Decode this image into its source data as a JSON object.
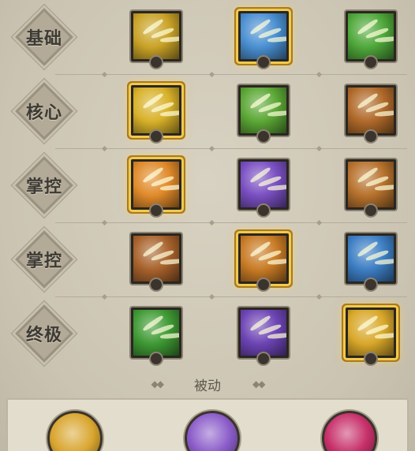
{
  "rows": [
    {
      "label": "基础",
      "skills": [
        {
          "icon": "golden-axe-icon",
          "color": "#c9a227",
          "selected": false
        },
        {
          "icon": "ice-axe-icon",
          "color": "#4a8fd1",
          "selected": true
        },
        {
          "icon": "green-axe-slash-icon",
          "color": "#4fa83a",
          "selected": false
        }
      ]
    },
    {
      "label": "核心",
      "skills": [
        {
          "icon": "golden-whirlwind-icon",
          "color": "#d8b12a",
          "selected": true
        },
        {
          "icon": "green-shatter-icon",
          "color": "#5ba735",
          "selected": false
        },
        {
          "icon": "bronze-totem-icon",
          "color": "#b06a2a",
          "selected": false
        }
      ]
    },
    {
      "label": "掌控",
      "skills": [
        {
          "icon": "fire-slash-icon",
          "color": "#e08a2a",
          "selected": true
        },
        {
          "icon": "purple-crystal-icon",
          "color": "#7a4fc2",
          "selected": false
        },
        {
          "icon": "earth-spikes-icon",
          "color": "#b7722d",
          "selected": false
        }
      ]
    },
    {
      "label": "掌控",
      "skills": [
        {
          "icon": "golem-rage-icon",
          "color": "#a8622c",
          "selected": false
        },
        {
          "icon": "roaring-beast-icon",
          "color": "#c87b25",
          "selected": true
        },
        {
          "icon": "ice-beast-icon",
          "color": "#3d7ec4",
          "selected": false
        }
      ]
    },
    {
      "label": "终极",
      "skills": [
        {
          "icon": "green-tornado-icon",
          "color": "#3f9a34",
          "selected": false
        },
        {
          "icon": "purple-demon-icon",
          "color": "#6d44b5",
          "selected": false
        },
        {
          "icon": "golden-titan-icon",
          "color": "#d9a82a",
          "selected": true
        }
      ]
    }
  ],
  "passive": {
    "title": "被动",
    "ornament_left": "◆◆",
    "ornament_right": "◆◆",
    "items": [
      {
        "icon": "golden-helmet-icon",
        "color": "#d9a630"
      },
      {
        "icon": "purple-crystal-shard-icon",
        "color": "#8b5cc9"
      },
      {
        "icon": "red-heart-icon",
        "color": "#c7306a"
      }
    ]
  },
  "badge_glyph": "🜂"
}
